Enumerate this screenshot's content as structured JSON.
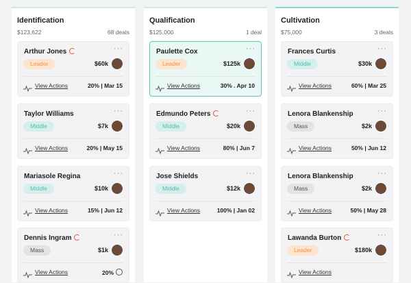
{
  "columns": [
    {
      "title": "Identification",
      "amount": "$123,622",
      "count": "68 deals",
      "cards": [
        {
          "name": "Arthur Jones",
          "flag": true,
          "tag": "Leader",
          "amount": "$60k",
          "link": "View Actions",
          "stats": "20% | Mar 15",
          "timer": false
        },
        {
          "name": "Taylor Williams",
          "flag": false,
          "tag": "Middle",
          "amount": "$7k",
          "link": "View Actions",
          "stats": "20% | May 15",
          "timer": false
        },
        {
          "name": "Mariasole Regina",
          "flag": false,
          "tag": "Middle",
          "amount": "$10k",
          "link": "View Actions",
          "stats": "15% | Jun 12",
          "timer": false
        },
        {
          "name": "Dennis Ingram",
          "flag": true,
          "tag": "Mass",
          "amount": "$1k",
          "link": "View Actions",
          "stats": "20%",
          "timer": true
        }
      ]
    },
    {
      "title": "Qualification",
      "amount": "$125,000",
      "count": "1 deal",
      "cards": [
        {
          "name": "Paulette Cox",
          "flag": false,
          "tag": "Leader",
          "amount": "$125k",
          "link": "View Actions",
          "stats": "30% . Apr 10",
          "timer": false,
          "active": true
        },
        {
          "name": "Edmundo Peters",
          "flag": true,
          "tag": "Middle",
          "amount": "$20k",
          "link": "View Actions",
          "stats": "80% | Jun 7",
          "timer": false
        },
        {
          "name": "Jose Shields",
          "flag": false,
          "tag": "Middle",
          "amount": "$12k",
          "link": "View Actions",
          "stats": "100% | Jan 02",
          "timer": false
        }
      ]
    },
    {
      "title": "Cultivation",
      "amount": "$75,000",
      "count": "3 deals",
      "cards": [
        {
          "name": "Frances Curtis",
          "flag": false,
          "tag": "Middle",
          "amount": "$30k",
          "link": "View Actions",
          "stats": "60% | Mar 25",
          "timer": false
        },
        {
          "name": "Lenora Blankenship",
          "flag": false,
          "tag": "Mass",
          "amount": "$2k",
          "link": "View Actions",
          "stats": "50% | Jun 12",
          "timer": false
        },
        {
          "name": "Lenora Blankenship",
          "flag": false,
          "tag": "Mass",
          "amount": "$2k",
          "link": "View Actions",
          "stats": "50% | May 28",
          "timer": false
        },
        {
          "name": "Lawanda Burton",
          "flag": true,
          "tag": "Leader",
          "amount": "$180k",
          "link": "View Actions",
          "stats": "",
          "timer": false
        }
      ]
    }
  ]
}
